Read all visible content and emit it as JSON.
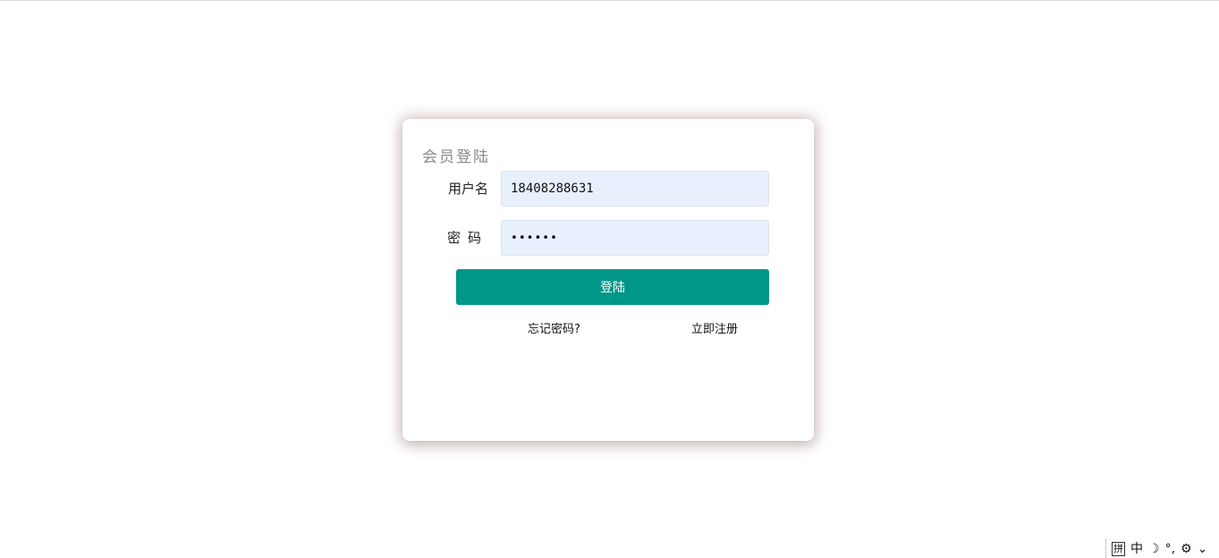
{
  "login": {
    "title": "会员登陆",
    "username_label": "用户名",
    "username_value": "18408288631",
    "password_label": "密码",
    "password_value": "••••••",
    "submit_label": "登陆",
    "forgot_link": "忘记密码?",
    "register_link": "立即注册"
  },
  "ime_toolbar": {
    "layout_glyph": "拼",
    "mode": "中",
    "moon": "☽",
    "punct": "°,",
    "settings": "⚙",
    "menu": "⌄"
  },
  "colors": {
    "primary": "#009688",
    "input_bg": "#e8f0fe",
    "card_shadow": "#c49aa0"
  }
}
